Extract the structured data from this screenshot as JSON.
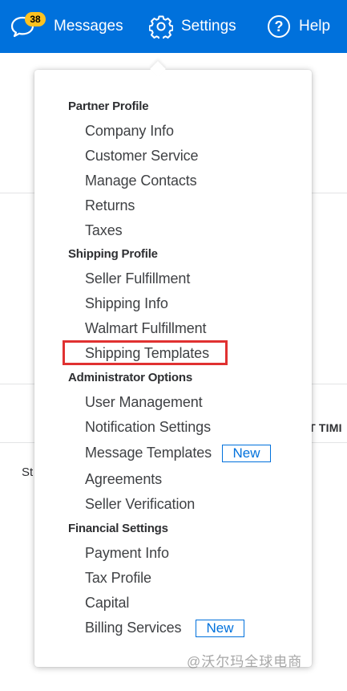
{
  "header": {
    "messages_label": "Messages",
    "messages_badge": "38",
    "settings_label": "Settings",
    "help_label": "Help",
    "help_glyph": "?",
    "bg_color": "#0071dc"
  },
  "background": {
    "column_header_fragment": "IT TIMI",
    "row_text_fragment": "St"
  },
  "menu": {
    "sections": [
      {
        "title": "Partner Profile",
        "items": [
          "Company Info",
          "Customer Service",
          "Manage Contacts",
          "Returns",
          "Taxes"
        ]
      },
      {
        "title": "Shipping Profile",
        "items": [
          "Seller Fulfillment",
          "Shipping Info",
          "Walmart Fulfillment",
          "Shipping Templates"
        ]
      },
      {
        "title": "Administrator Options",
        "items": [
          "User Management",
          "Notification Settings",
          "Message Templates",
          "Agreements",
          "Seller Verification"
        ]
      },
      {
        "title": "Financial Settings",
        "items": [
          "Payment Info",
          "Tax Profile",
          "Capital",
          "Billing Services"
        ]
      }
    ],
    "new_badge_label": "New",
    "highlighted_item": "Shipping Templates",
    "highlight_color": "#e03131"
  },
  "watermark": "@沃尔玛全球电商"
}
